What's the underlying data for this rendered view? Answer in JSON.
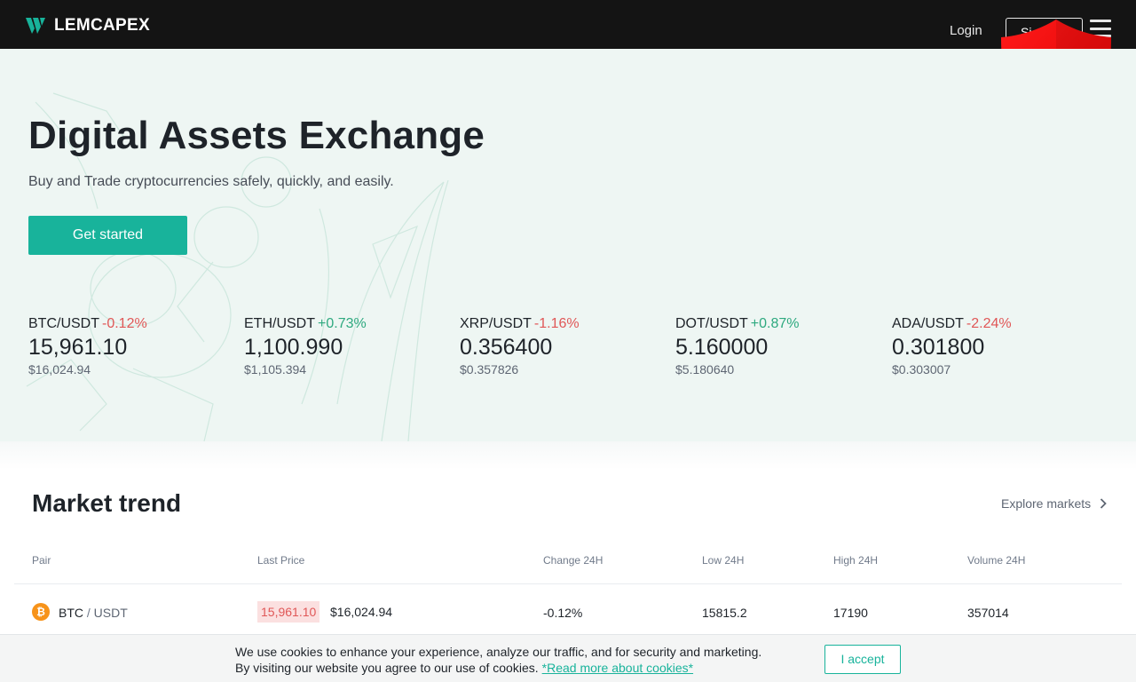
{
  "header": {
    "brand": "LEMCAPEX",
    "login_label": "Login",
    "signup_label": "Si",
    "menu_icon": "hamburger-icon",
    "overlay_icon": "red-shield-x-icon"
  },
  "hero": {
    "title": "Digital Assets Exchange",
    "subtitle": "Buy and Trade cryptocurrencies safely, quickly, and easily.",
    "cta_label": "Get started",
    "tickers": [
      {
        "pair": "BTC/USDT",
        "change": "-0.12%",
        "direction": "down",
        "price": "15,961.10",
        "usd": "$16,024.94"
      },
      {
        "pair": "ETH/USDT",
        "change": "+0.73%",
        "direction": "up",
        "price": "1,100.990",
        "usd": "$1,105.394"
      },
      {
        "pair": "XRP/USDT",
        "change": "-1.16%",
        "direction": "down",
        "price": "0.356400",
        "usd": "$0.357826"
      },
      {
        "pair": "DOT/USDT",
        "change": "+0.87%",
        "direction": "up",
        "price": "5.160000",
        "usd": "$5.180640"
      },
      {
        "pair": "ADA/USDT",
        "change": "-2.24%",
        "direction": "down",
        "price": "0.301800",
        "usd": "$0.303007"
      }
    ]
  },
  "market": {
    "title": "Market trend",
    "explore_label": "Explore markets",
    "columns": [
      "Pair",
      "Last Price",
      "Change 24H",
      "Low 24H",
      "High 24H",
      "Volume 24H"
    ],
    "rows": [
      {
        "icon": "bitcoin-icon",
        "base": "BTC",
        "separator": "/",
        "quote": "USDT",
        "last_price": "15,961.10",
        "last_usd": "$16,024.94",
        "change": "-0.12%",
        "low": "15815.2",
        "high": "17190",
        "volume": "357014"
      }
    ]
  },
  "cookie": {
    "line1": "We use cookies to enhance your experience, analyze our traffic, and for security and marketing.",
    "line2": "By visiting our website you agree to our use of cookies.",
    "link_label": "*Read more about cookies*",
    "accept_label": "I accept"
  },
  "colors": {
    "accent": "#18b39b",
    "negative": "#e05757",
    "positive": "#2ea97f",
    "header_bg": "#141414",
    "hero_bg": "#eef6f3"
  }
}
